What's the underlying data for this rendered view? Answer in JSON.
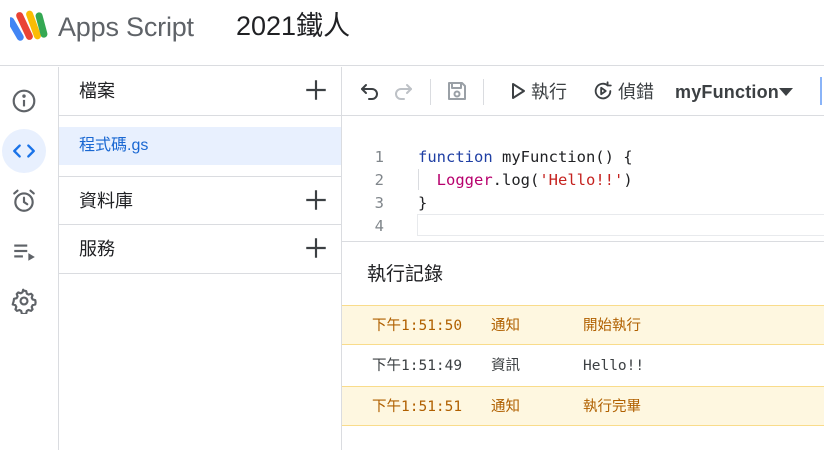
{
  "header": {
    "app_name": "Apps Script",
    "project_name": "2021鐵人"
  },
  "rail": {
    "items": [
      {
        "name": "overview",
        "icon": "info-icon"
      },
      {
        "name": "editor",
        "icon": "code-icon",
        "active": true
      },
      {
        "name": "triggers",
        "icon": "alarm-icon"
      },
      {
        "name": "executions",
        "icon": "executions-icon"
      },
      {
        "name": "settings",
        "icon": "gear-icon"
      }
    ]
  },
  "files": {
    "sections": [
      {
        "title": "檔案"
      },
      {
        "title": "資料庫"
      },
      {
        "title": "服務"
      }
    ],
    "items": [
      {
        "name": "程式碼.gs",
        "selected": true
      }
    ]
  },
  "toolbar": {
    "run_label": "執行",
    "debug_label": "偵錯",
    "function_name": "myFunction"
  },
  "editor": {
    "line_numbers": [
      "1",
      "2",
      "3",
      "4"
    ],
    "tokens": {
      "l1_kw": "function",
      "l1_rest": " myFunction() {",
      "l2_indent": "  ",
      "l2_obj": "Logger",
      "l2_dot": ".log(",
      "l2_str": "'Hello!!'",
      "l2_close": ")",
      "l3": "}"
    }
  },
  "log": {
    "title": "執行記錄",
    "rows": [
      {
        "time": "下午1:51:50",
        "level": "通知",
        "message": "開始執行",
        "type": "notice"
      },
      {
        "time": "下午1:51:49",
        "level": "資訊",
        "message": "Hello!!",
        "type": "info"
      },
      {
        "time": "下午1:51:51",
        "level": "通知",
        "message": "執行完畢",
        "type": "notice"
      }
    ]
  },
  "colors": {
    "accent": "#1a73e8",
    "active_bg": "#e8f0fe",
    "notice_bg": "#fef7e0",
    "notice_text": "#b06000",
    "keyword": "#1f3fa4",
    "string": "#b7006d"
  }
}
